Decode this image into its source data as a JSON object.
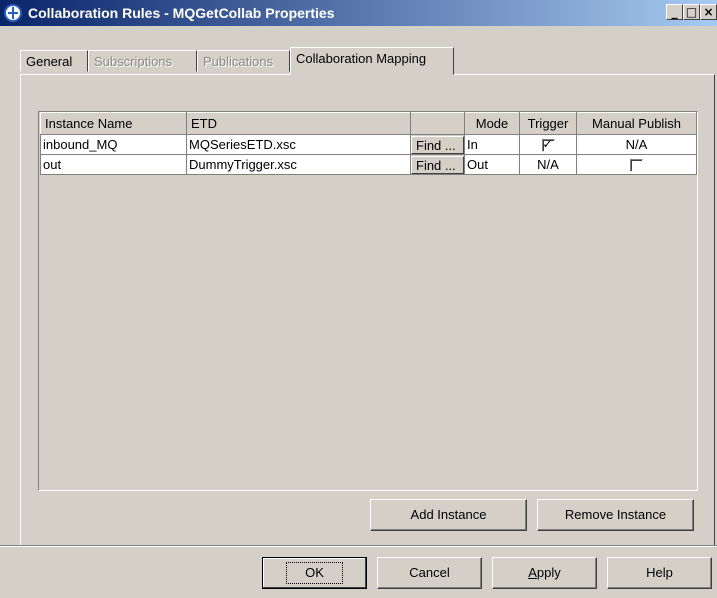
{
  "window": {
    "title": "Collaboration Rules - MQGetCollab Properties",
    "controls": [
      "_",
      "□",
      "×"
    ]
  },
  "tabs": [
    {
      "label": "General",
      "state": "normal"
    },
    {
      "label": "Subscriptions",
      "state": "disabled"
    },
    {
      "label": "Publications",
      "state": "disabled"
    },
    {
      "label": "Collaboration Mapping",
      "state": "active"
    }
  ],
  "table": {
    "headers": [
      "Instance Name",
      "ETD",
      "",
      "Mode",
      "Trigger",
      "Manual Publish"
    ],
    "rows": [
      {
        "instance": "inbound_MQ",
        "etd": "MQSeriesETD.xsc",
        "find": "Find ...",
        "mode": "In",
        "trigger": "checked",
        "manual_publish": "N/A"
      },
      {
        "instance": "out",
        "etd": "DummyTrigger.xsc",
        "find": "Find ...",
        "mode": "Out",
        "trigger": "N/A",
        "manual_publish": "unchecked"
      }
    ]
  },
  "panel_buttons": {
    "add_instance": "Add Instance",
    "remove_instance": "Remove Instance"
  },
  "dialog_buttons": {
    "ok": "OK",
    "cancel": "Cancel",
    "apply_prefix": "A",
    "apply_rest": "pply",
    "help": "Help"
  }
}
